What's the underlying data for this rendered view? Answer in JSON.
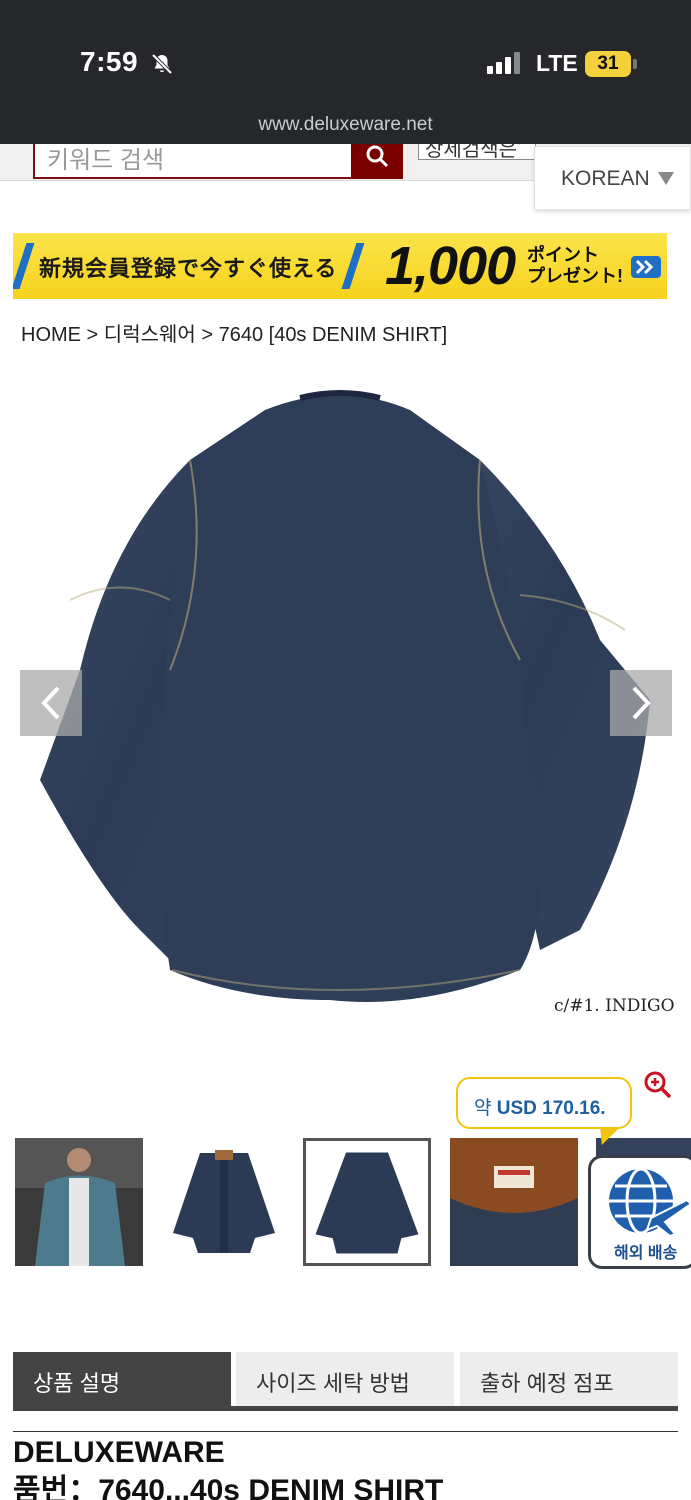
{
  "status_bar": {
    "time": "7:59",
    "network": "LTE",
    "battery": "31",
    "url": "www.deluxeware.net"
  },
  "search": {
    "placeholder": "키워드 검색",
    "category": "상세검색은"
  },
  "language": {
    "selected": "KOREAN"
  },
  "promo_banner": {
    "text": "新規会員登録で今すぐ使える",
    "amount": "1,000",
    "suffix_line1": "ポイント",
    "suffix_line2": "プレゼント!"
  },
  "breadcrumb": {
    "text": "HOME > 디럭스웨어 > 7640 [40s DENIM SHIRT]"
  },
  "product_image": {
    "caption": "c/#1. INDIGO"
  },
  "price_bubble": {
    "prefix": "약",
    "amount": "USD 170.16."
  },
  "shipping_widget": {
    "label": "해외 배송"
  },
  "tabs": [
    {
      "label": "상품 설명"
    },
    {
      "label": "사이즈 세탁 방법"
    },
    {
      "label": "출하 예정 점포"
    }
  ],
  "product": {
    "brand": "DELUXEWARE",
    "name": "품번：7640...40s DENIM SHIRT"
  },
  "colors": {
    "status_bg": "#25272b",
    "search_accent": "#7a0000",
    "promo_yellow": "#f6d21e",
    "denim": "#2c3b55",
    "tab_active": "#444444",
    "price_blue": "#1f5f9e"
  }
}
